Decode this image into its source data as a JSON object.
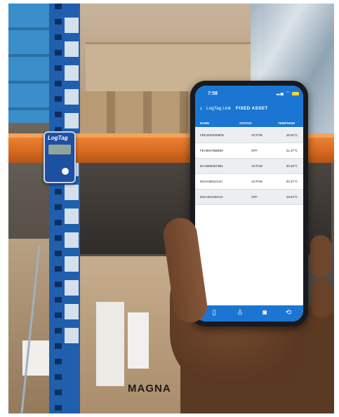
{
  "device": {
    "brand": "LogTag"
  },
  "carton": {
    "brand_text": "MAGNA"
  },
  "phone": {
    "status_bar": {
      "time": "7:58"
    },
    "header": {
      "back_label": "LogTag Link",
      "title": "FIXED ASSET"
    },
    "columns": {
      "name": "NAME",
      "status": "STATUS",
      "temperature": "TEMP/HUM"
    },
    "rows": [
      {
        "name": "FBC2DD4008FB",
        "status": "ACTIVE",
        "temp": "19.00°C"
      },
      {
        "name": "FEA8947BBB09",
        "status": "OFF",
        "temp": "21.27°C"
      },
      {
        "name": "DAAB864574B1",
        "status": "ACTIVE",
        "temp": "20.30°C"
      },
      {
        "name": "D01A060121JH",
        "status": "ACTIVE",
        "temp": "20.37°C"
      },
      {
        "name": "D11A91234GU4",
        "status": "OFF",
        "temp": "19.84°C"
      }
    ],
    "tabs": [
      "phone-icon",
      "sensor-icon",
      "camera-icon",
      "sync-icon"
    ],
    "colors": {
      "accent": "#1a76d2",
      "battery": "#f7d43a"
    }
  }
}
